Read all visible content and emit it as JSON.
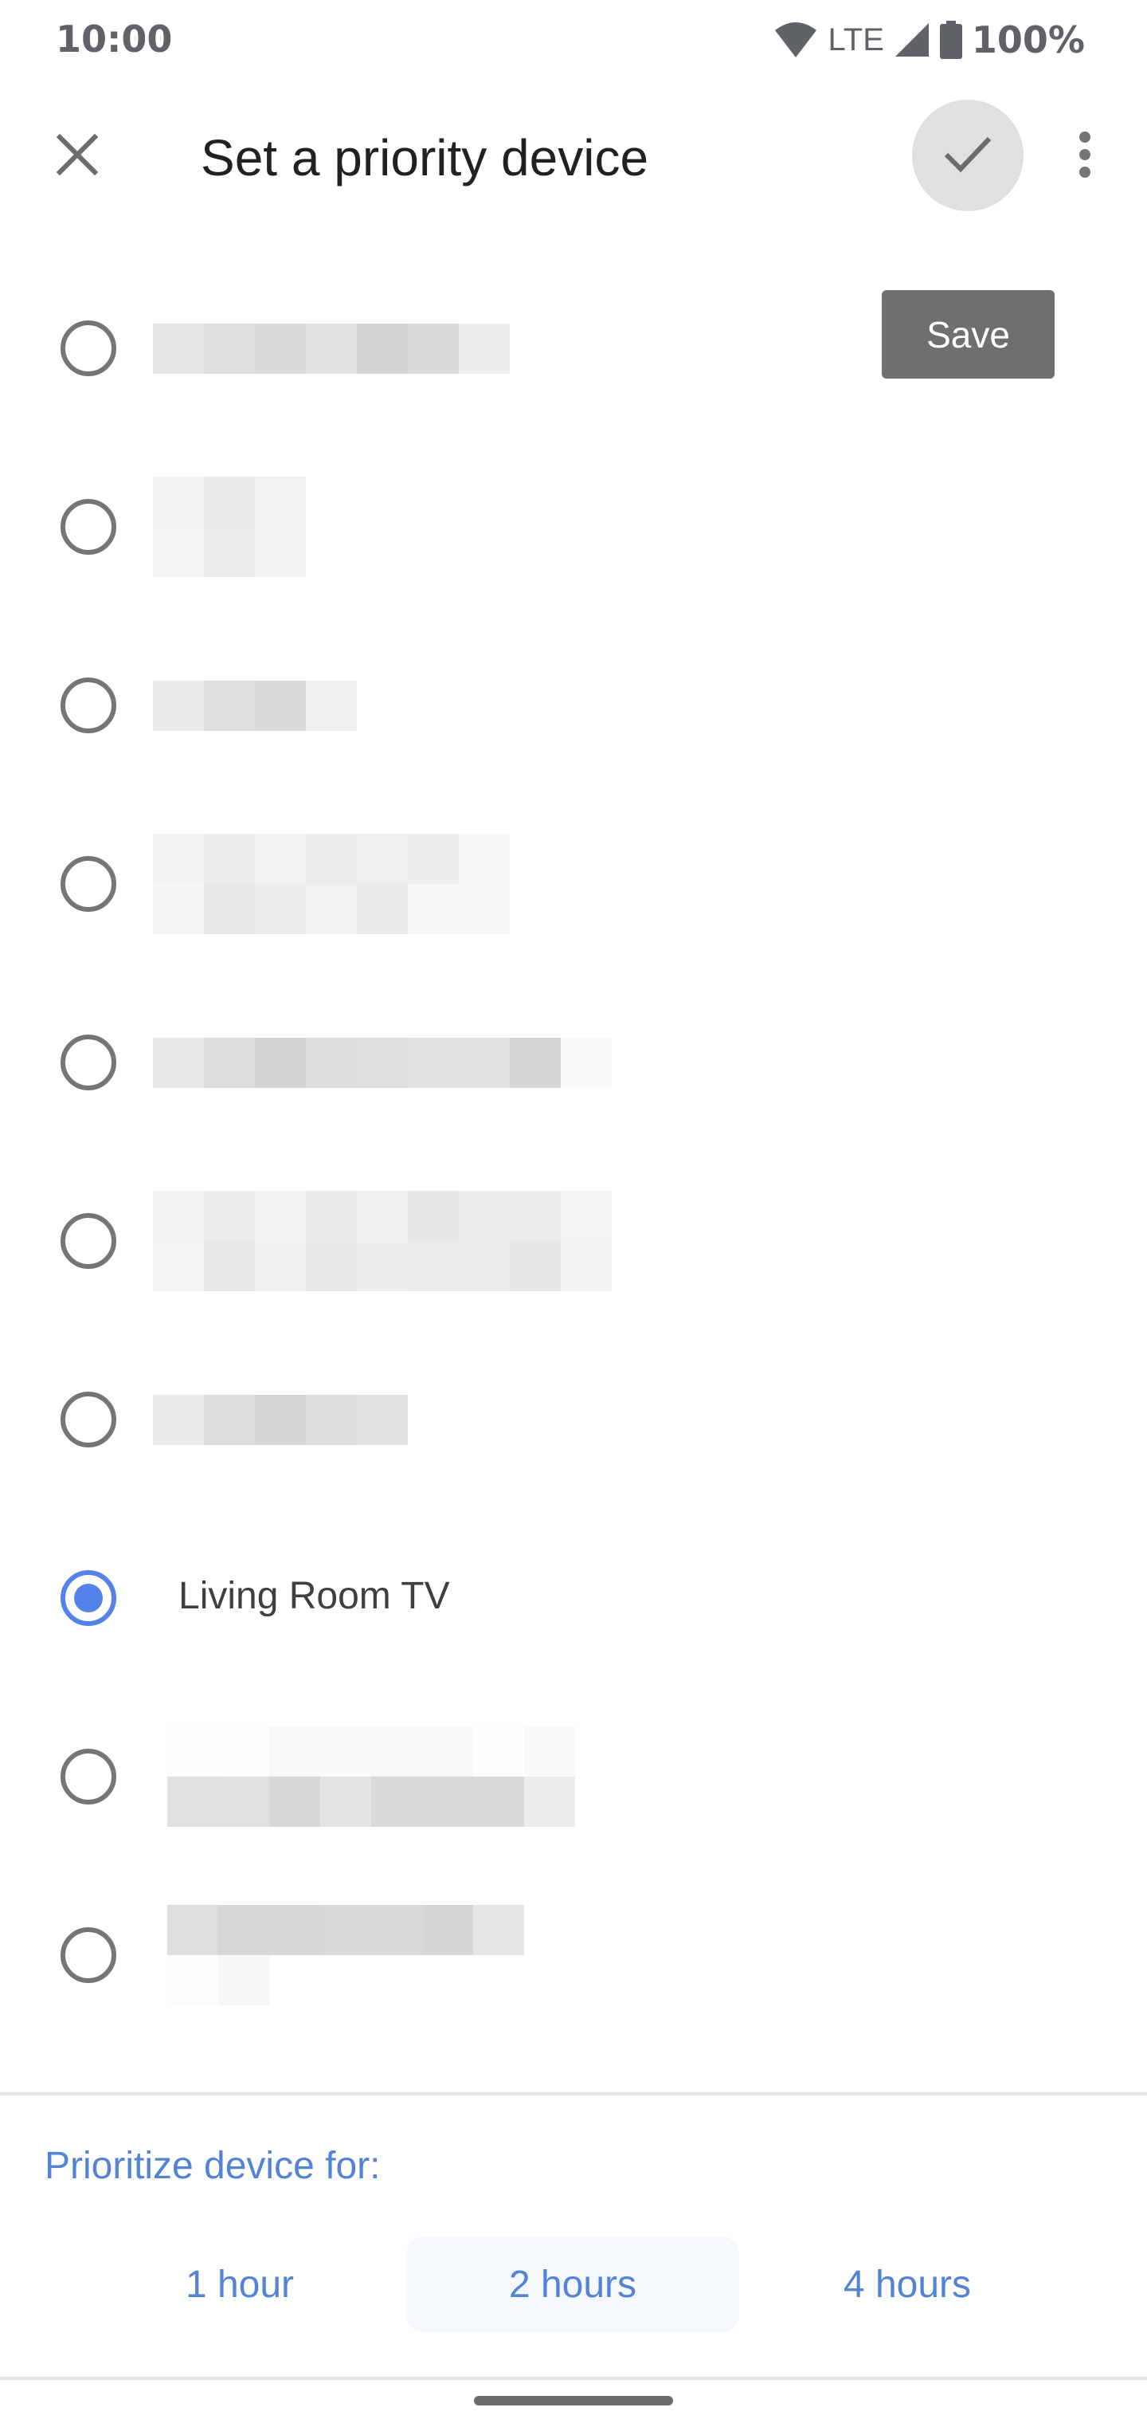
{
  "status_bar": {
    "time": "10:00",
    "network_label": "LTE",
    "battery_percent": "100%",
    "icons": [
      "wifi-icon",
      "signal-icon",
      "battery-icon"
    ]
  },
  "header": {
    "title": "Set a priority device",
    "close_icon": "close-icon",
    "confirm_icon": "check-icon",
    "more_icon": "more-vert-icon"
  },
  "tooltip": {
    "label": "Save"
  },
  "devices": [
    {
      "label": null,
      "redacted": true,
      "selected": false,
      "lines": 1
    },
    {
      "label": null,
      "redacted": true,
      "selected": false,
      "lines": 2
    },
    {
      "label": null,
      "redacted": true,
      "selected": false,
      "lines": 1
    },
    {
      "label": null,
      "redacted": true,
      "selected": false,
      "lines": 2
    },
    {
      "label": null,
      "redacted": true,
      "selected": false,
      "lines": 1
    },
    {
      "label": null,
      "redacted": true,
      "selected": false,
      "lines": 2
    },
    {
      "label": null,
      "redacted": true,
      "selected": false,
      "lines": 1
    },
    {
      "label": "Living Room TV",
      "redacted": false,
      "selected": true,
      "lines": 1
    },
    {
      "label": null,
      "redacted": true,
      "selected": false,
      "lines": 2
    },
    {
      "label": null,
      "redacted": true,
      "selected": false,
      "lines": 2
    }
  ],
  "duration": {
    "label": "Prioritize device for:",
    "options": [
      {
        "label": "1 hour",
        "selected": false
      },
      {
        "label": "2 hours",
        "selected": true
      },
      {
        "label": "4 hours",
        "selected": false
      }
    ]
  },
  "colors": {
    "accent": "#5383e8",
    "accent_text": "#5383d4",
    "icon_gray": "#757575",
    "tooltip_bg": "#6f6f6f",
    "check_button_bg": "#e0e0e0"
  }
}
